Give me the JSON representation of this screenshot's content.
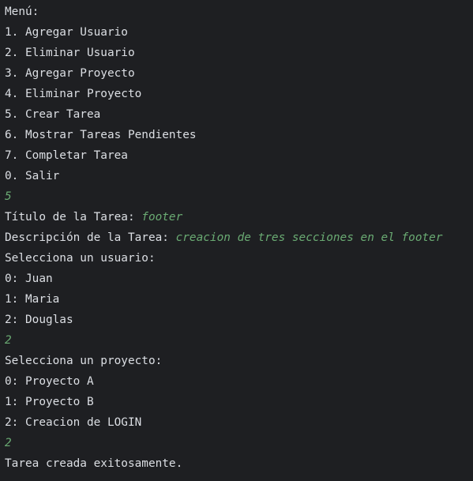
{
  "console": {
    "menu_title": "Menú:",
    "menu_options": [
      "1. Agregar Usuario",
      "2. Eliminar Usuario",
      "3. Agregar Proyecto",
      "4. Eliminar Proyecto",
      "5. Crear Tarea",
      "6. Mostrar Tareas Pendientes",
      "7. Completar Tarea",
      "0. Salir"
    ],
    "menu_choice": "5",
    "task_title_prompt": "Título de la Tarea: ",
    "task_title_value": "footer",
    "task_desc_prompt": "Descripción de la Tarea: ",
    "task_desc_value": "creacion de tres secciones en el footer",
    "select_user_prompt": "Selecciona un usuario:",
    "users": [
      "0: Juan",
      "1: Maria",
      "2: Douglas"
    ],
    "user_choice": "2",
    "select_project_prompt": "Selecciona un proyecto:",
    "projects": [
      "0: Proyecto A",
      "1: Proyecto B",
      "2: Creacion de LOGIN"
    ],
    "project_choice": "2",
    "result_message": "Tarea creada exitosamente."
  },
  "colors": {
    "background": "#1e1f22",
    "output_text": "#dcdfe4",
    "user_input": "#6aab73"
  }
}
